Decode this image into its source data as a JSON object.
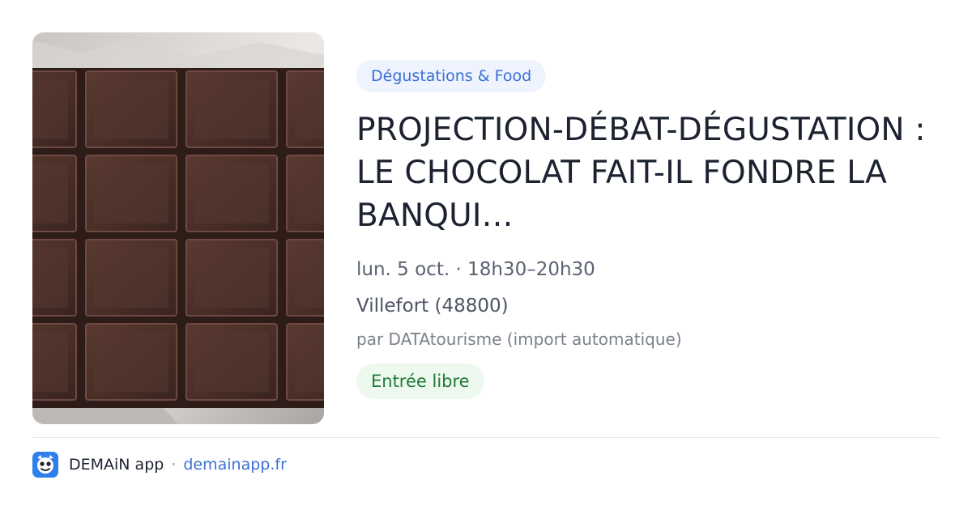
{
  "event": {
    "image_alt": "chocolate-bar-photo",
    "category": "Dégustations & Food",
    "title": "PROJECTION-DÉBAT-DÉGUSTATION : LE CHOCOLAT FAIT-IL FONDRE LA BANQUI…",
    "datetime": "lun. 5 oct. · 18h30–20h30",
    "location": "Villefort (48800)",
    "organizer": "par DATAtourisme (import automatique)",
    "price": "Entrée libre"
  },
  "footer": {
    "app_icon": "demain-app-logo-icon",
    "app_name": "DEMAiN app",
    "separator": "·",
    "site": "demainapp.fr"
  },
  "colors": {
    "accent": "#3a6fd8",
    "category_bg": "#eef3fd",
    "price_text": "#1f7a35",
    "price_bg": "#edf8ee",
    "title": "#1c2230"
  }
}
